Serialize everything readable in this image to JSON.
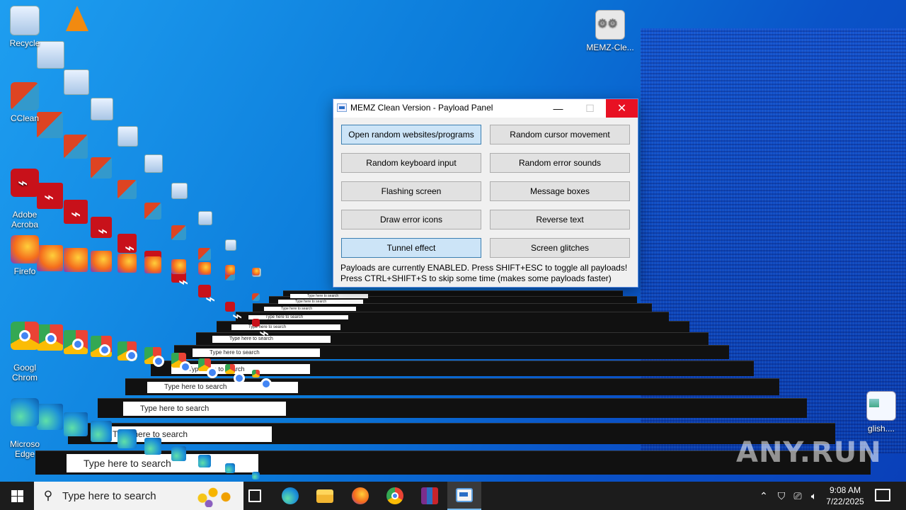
{
  "desktop": {
    "icons": [
      {
        "name": "recycle-bin-icon",
        "label": "Recycle"
      },
      {
        "name": "vlc-icon",
        "label": ""
      },
      {
        "name": "ccleaner-icon",
        "label": "CClean"
      },
      {
        "name": "acrobat-icon",
        "label": "Adobe\nAcroba"
      },
      {
        "name": "firefox-icon",
        "label": "Firefo"
      },
      {
        "name": "chrome-icon",
        "label": "Googl\nChrom"
      },
      {
        "name": "edge-icon",
        "label": "Microso\nEdge"
      },
      {
        "name": "memz-clean-icon",
        "label": "MEMZ-Cle..."
      },
      {
        "name": "file-icon",
        "label": "glish...."
      }
    ]
  },
  "memz_window": {
    "title": "MEMZ Clean Version - Payload Panel",
    "minimize": "—",
    "maximize": "☐",
    "close": "✕",
    "buttons": [
      {
        "label": "Open random websites/programs",
        "enabled": true
      },
      {
        "label": "Random cursor movement",
        "enabled": false
      },
      {
        "label": "Random keyboard input",
        "enabled": false
      },
      {
        "label": "Random error sounds",
        "enabled": false
      },
      {
        "label": "Flashing screen",
        "enabled": false
      },
      {
        "label": "Message boxes",
        "enabled": false
      },
      {
        "label": "Draw error icons",
        "enabled": false
      },
      {
        "label": "Reverse text",
        "enabled": false
      },
      {
        "label": "Tunnel effect",
        "enabled": true
      },
      {
        "label": "Screen glitches",
        "enabled": false
      }
    ],
    "status_line1": "Payloads are currently ENABLED. Press SHIFT+ESC to toggle all payloads!",
    "status_line2": "Press CTRL+SHIFT+S to skip some time (makes some payloads faster)"
  },
  "taskbar": {
    "search_placeholder": "Type here to search",
    "search_icon": "magnifier-icon",
    "apps": [
      "task-view-icon",
      "edge-icon",
      "file-explorer-icon",
      "firefox-icon",
      "chrome-icon",
      "winrar-icon",
      "memz-icon"
    ],
    "active_app": "memz-icon",
    "tray": {
      "chevron": "⌃",
      "time": "9:08 AM",
      "date": "7/22/2025"
    }
  },
  "ghost_search_text": "Type here to search",
  "watermark": "ANY.RUN",
  "colors": {
    "desktop_blue": "#0a78d8",
    "close_red": "#e81123",
    "toggle_on": "#cce4f7",
    "taskbar": "#1c1c1c"
  }
}
